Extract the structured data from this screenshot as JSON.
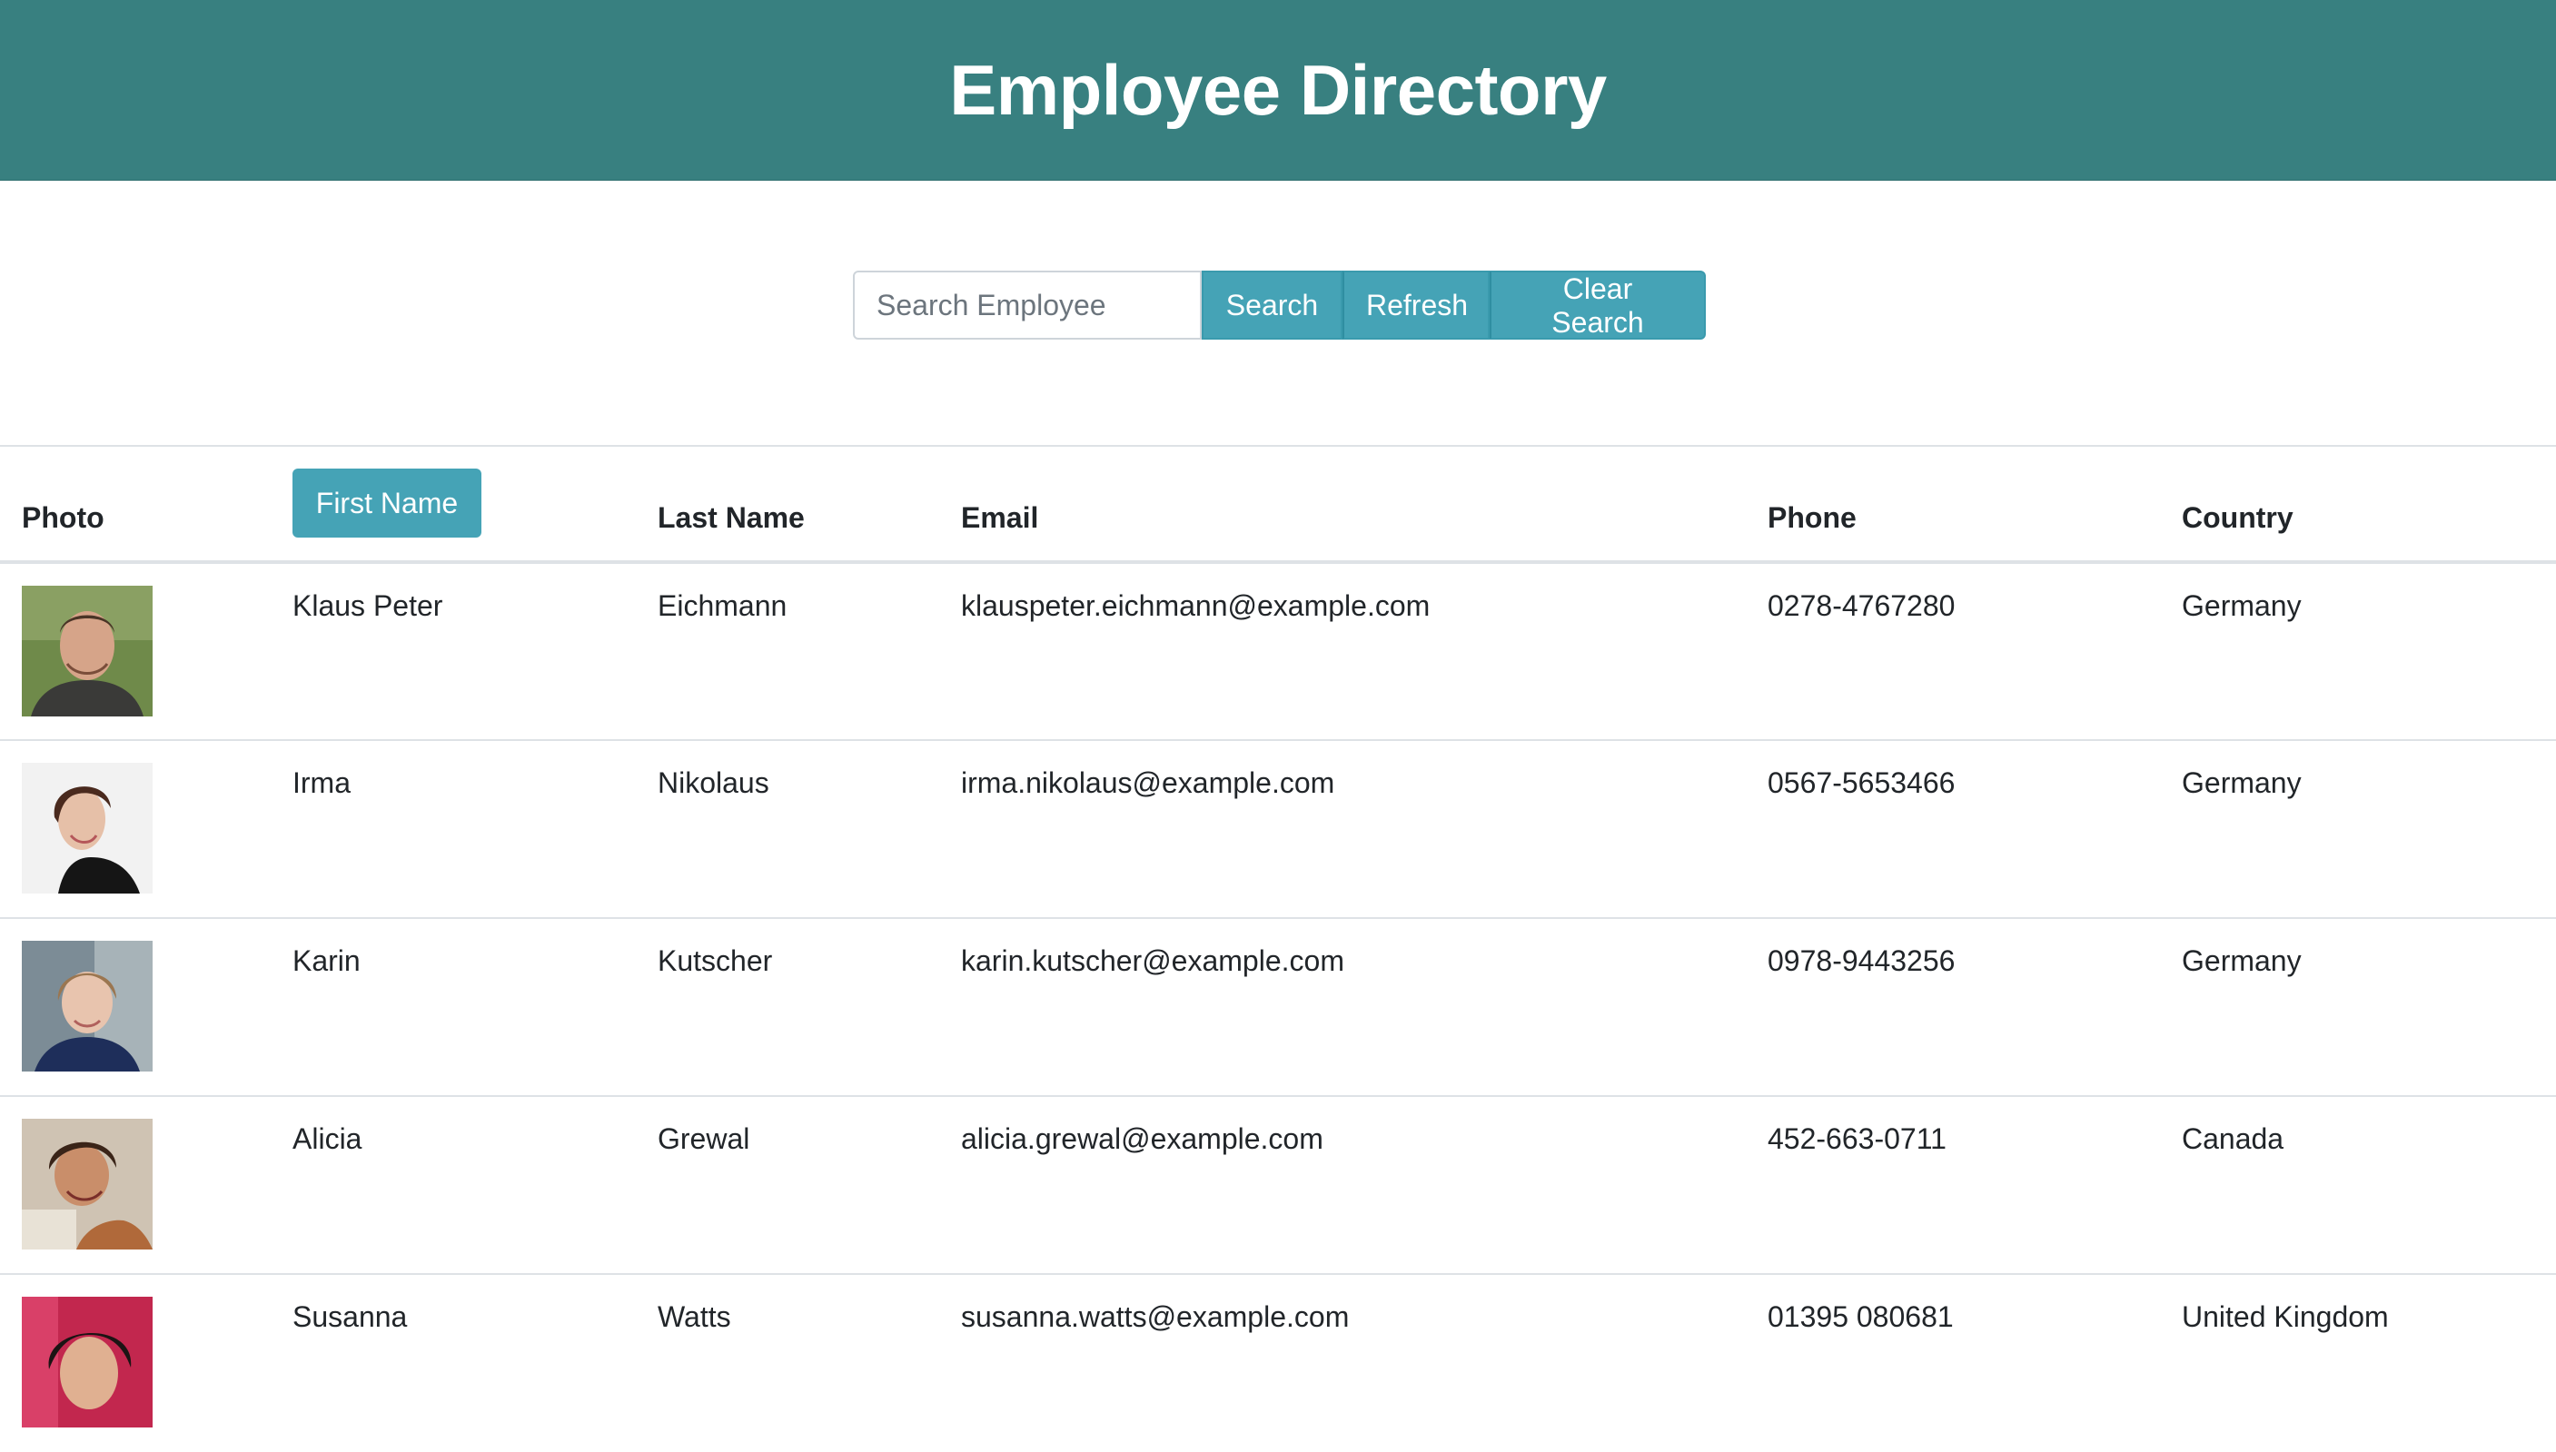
{
  "header": {
    "title": "Employee Directory",
    "bg_color": "#388080"
  },
  "search": {
    "placeholder": "Search Employee",
    "value": "",
    "search_label": "Search",
    "refresh_label": "Refresh",
    "clear_label": "Clear Search",
    "accent_color": "#45a3b6"
  },
  "table": {
    "columns": {
      "photo": "Photo",
      "first_name": "First Name",
      "last_name": "Last Name",
      "email": "Email",
      "phone": "Phone",
      "country": "Country"
    },
    "rows": [
      {
        "first_name": "Klaus Peter",
        "last_name": "Eichmann",
        "email": "klauspeter.eichmann@example.com",
        "phone": "0278-4767280",
        "country": "Germany"
      },
      {
        "first_name": "Irma",
        "last_name": "Nikolaus",
        "email": "irma.nikolaus@example.com",
        "phone": "0567-5653466",
        "country": "Germany"
      },
      {
        "first_name": "Karin",
        "last_name": "Kutscher",
        "email": "karin.kutscher@example.com",
        "phone": "0978-9443256",
        "country": "Germany"
      },
      {
        "first_name": "Alicia",
        "last_name": "Grewal",
        "email": "alicia.grewal@example.com",
        "phone": "452-663-0711",
        "country": "Canada"
      },
      {
        "first_name": "Susanna",
        "last_name": "Watts",
        "email": "susanna.watts@example.com",
        "phone": "01395 080681",
        "country": "United Kingdom"
      }
    ]
  }
}
